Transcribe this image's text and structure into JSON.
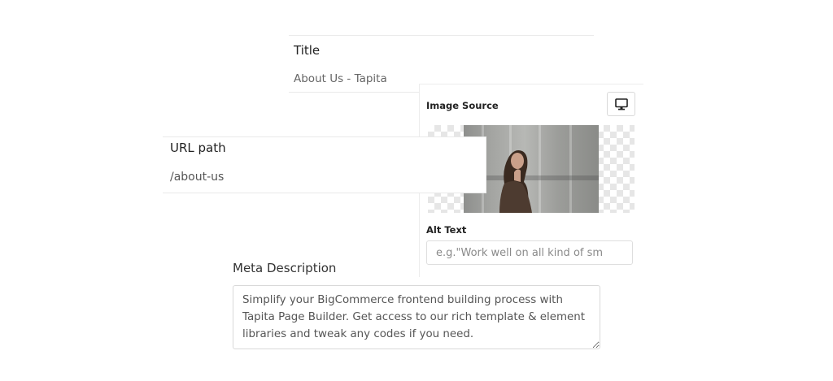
{
  "title_field": {
    "label": "Title",
    "value": "About Us - Tapita"
  },
  "image_panel": {
    "source_label": "Image Source",
    "device_icon": "desktop-icon",
    "alt_label": "Alt Text",
    "alt_placeholder": "e.g.\"Work well on all kind of sm"
  },
  "url_field": {
    "label": "URL path",
    "value": "/about-us"
  },
  "meta": {
    "label": "Meta Description",
    "value": "Simplify your BigCommerce frontend building process with Tapita Page Builder. Get access to our rich template & element libraries and tweak any codes if you need."
  }
}
